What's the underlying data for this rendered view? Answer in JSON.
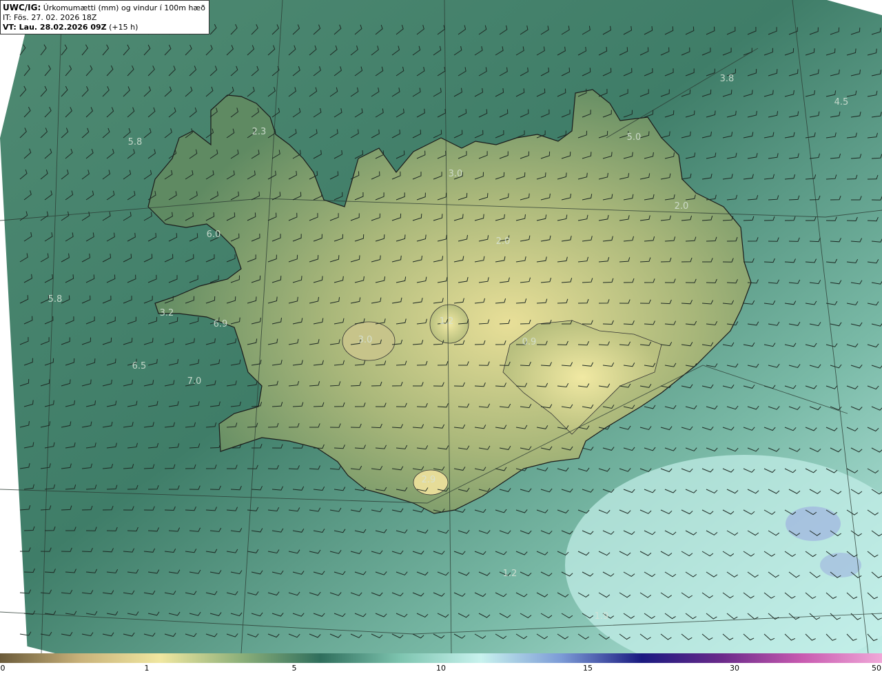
{
  "header": {
    "model": "UWC/IG:",
    "product": "Úrkomumætti (mm) og vindur í 100m hæð",
    "issue_time": "IT: Fös. 27. 02. 2026 18Z",
    "valid_prefix": "VT: Lau. 28.02.2026 09Z",
    "valid_suffix": "(+15 h)"
  },
  "map_labels": [
    "3.8",
    "4.5",
    "5.0",
    "5.8",
    "6.0",
    "5.8",
    "3.2",
    "6.9",
    "6.5",
    "7.0",
    "2.9",
    "2.0",
    "3.0",
    "1.2",
    "0.9",
    "3.0",
    "2.3",
    "2.0",
    "1.9",
    "1.2"
  ],
  "colorbar": {
    "ticks": [
      "0",
      "1",
      "5",
      "10",
      "15",
      "30",
      "50"
    ],
    "colors": [
      "#6b5b3a",
      "#c9b27a",
      "#f0e7a0",
      "#8db07a",
      "#2f6e5c",
      "#7ec5b0",
      "#c8f2ee",
      "#7c9bd6",
      "#1a1a80",
      "#6a2a8a",
      "#c85ab0",
      "#f0a8d8"
    ]
  }
}
